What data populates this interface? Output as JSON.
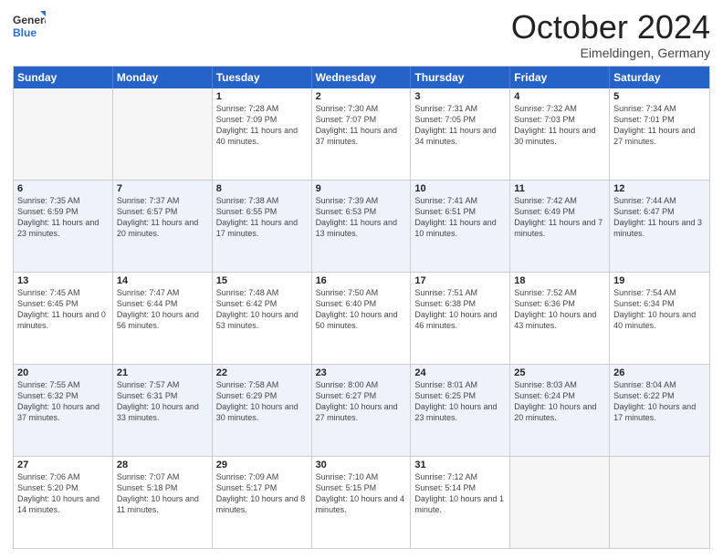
{
  "header": {
    "logo_general": "General",
    "logo_blue": "Blue",
    "month_title": "October 2024",
    "location": "Eimeldingen, Germany"
  },
  "days_of_week": [
    "Sunday",
    "Monday",
    "Tuesday",
    "Wednesday",
    "Thursday",
    "Friday",
    "Saturday"
  ],
  "weeks": [
    [
      {
        "day": "",
        "sunrise": "",
        "sunset": "",
        "daylight": "",
        "empty": true
      },
      {
        "day": "",
        "sunrise": "",
        "sunset": "",
        "daylight": "",
        "empty": true
      },
      {
        "day": "1",
        "sunrise": "Sunrise: 7:28 AM",
        "sunset": "Sunset: 7:09 PM",
        "daylight": "Daylight: 11 hours and 40 minutes.",
        "empty": false
      },
      {
        "day": "2",
        "sunrise": "Sunrise: 7:30 AM",
        "sunset": "Sunset: 7:07 PM",
        "daylight": "Daylight: 11 hours and 37 minutes.",
        "empty": false
      },
      {
        "day": "3",
        "sunrise": "Sunrise: 7:31 AM",
        "sunset": "Sunset: 7:05 PM",
        "daylight": "Daylight: 11 hours and 34 minutes.",
        "empty": false
      },
      {
        "day": "4",
        "sunrise": "Sunrise: 7:32 AM",
        "sunset": "Sunset: 7:03 PM",
        "daylight": "Daylight: 11 hours and 30 minutes.",
        "empty": false
      },
      {
        "day": "5",
        "sunrise": "Sunrise: 7:34 AM",
        "sunset": "Sunset: 7:01 PM",
        "daylight": "Daylight: 11 hours and 27 minutes.",
        "empty": false
      }
    ],
    [
      {
        "day": "6",
        "sunrise": "Sunrise: 7:35 AM",
        "sunset": "Sunset: 6:59 PM",
        "daylight": "Daylight: 11 hours and 23 minutes.",
        "empty": false
      },
      {
        "day": "7",
        "sunrise": "Sunrise: 7:37 AM",
        "sunset": "Sunset: 6:57 PM",
        "daylight": "Daylight: 11 hours and 20 minutes.",
        "empty": false
      },
      {
        "day": "8",
        "sunrise": "Sunrise: 7:38 AM",
        "sunset": "Sunset: 6:55 PM",
        "daylight": "Daylight: 11 hours and 17 minutes.",
        "empty": false
      },
      {
        "day": "9",
        "sunrise": "Sunrise: 7:39 AM",
        "sunset": "Sunset: 6:53 PM",
        "daylight": "Daylight: 11 hours and 13 minutes.",
        "empty": false
      },
      {
        "day": "10",
        "sunrise": "Sunrise: 7:41 AM",
        "sunset": "Sunset: 6:51 PM",
        "daylight": "Daylight: 11 hours and 10 minutes.",
        "empty": false
      },
      {
        "day": "11",
        "sunrise": "Sunrise: 7:42 AM",
        "sunset": "Sunset: 6:49 PM",
        "daylight": "Daylight: 11 hours and 7 minutes.",
        "empty": false
      },
      {
        "day": "12",
        "sunrise": "Sunrise: 7:44 AM",
        "sunset": "Sunset: 6:47 PM",
        "daylight": "Daylight: 11 hours and 3 minutes.",
        "empty": false
      }
    ],
    [
      {
        "day": "13",
        "sunrise": "Sunrise: 7:45 AM",
        "sunset": "Sunset: 6:45 PM",
        "daylight": "Daylight: 11 hours and 0 minutes.",
        "empty": false
      },
      {
        "day": "14",
        "sunrise": "Sunrise: 7:47 AM",
        "sunset": "Sunset: 6:44 PM",
        "daylight": "Daylight: 10 hours and 56 minutes.",
        "empty": false
      },
      {
        "day": "15",
        "sunrise": "Sunrise: 7:48 AM",
        "sunset": "Sunset: 6:42 PM",
        "daylight": "Daylight: 10 hours and 53 minutes.",
        "empty": false
      },
      {
        "day": "16",
        "sunrise": "Sunrise: 7:50 AM",
        "sunset": "Sunset: 6:40 PM",
        "daylight": "Daylight: 10 hours and 50 minutes.",
        "empty": false
      },
      {
        "day": "17",
        "sunrise": "Sunrise: 7:51 AM",
        "sunset": "Sunset: 6:38 PM",
        "daylight": "Daylight: 10 hours and 46 minutes.",
        "empty": false
      },
      {
        "day": "18",
        "sunrise": "Sunrise: 7:52 AM",
        "sunset": "Sunset: 6:36 PM",
        "daylight": "Daylight: 10 hours and 43 minutes.",
        "empty": false
      },
      {
        "day": "19",
        "sunrise": "Sunrise: 7:54 AM",
        "sunset": "Sunset: 6:34 PM",
        "daylight": "Daylight: 10 hours and 40 minutes.",
        "empty": false
      }
    ],
    [
      {
        "day": "20",
        "sunrise": "Sunrise: 7:55 AM",
        "sunset": "Sunset: 6:32 PM",
        "daylight": "Daylight: 10 hours and 37 minutes.",
        "empty": false
      },
      {
        "day": "21",
        "sunrise": "Sunrise: 7:57 AM",
        "sunset": "Sunset: 6:31 PM",
        "daylight": "Daylight: 10 hours and 33 minutes.",
        "empty": false
      },
      {
        "day": "22",
        "sunrise": "Sunrise: 7:58 AM",
        "sunset": "Sunset: 6:29 PM",
        "daylight": "Daylight: 10 hours and 30 minutes.",
        "empty": false
      },
      {
        "day": "23",
        "sunrise": "Sunrise: 8:00 AM",
        "sunset": "Sunset: 6:27 PM",
        "daylight": "Daylight: 10 hours and 27 minutes.",
        "empty": false
      },
      {
        "day": "24",
        "sunrise": "Sunrise: 8:01 AM",
        "sunset": "Sunset: 6:25 PM",
        "daylight": "Daylight: 10 hours and 23 minutes.",
        "empty": false
      },
      {
        "day": "25",
        "sunrise": "Sunrise: 8:03 AM",
        "sunset": "Sunset: 6:24 PM",
        "daylight": "Daylight: 10 hours and 20 minutes.",
        "empty": false
      },
      {
        "day": "26",
        "sunrise": "Sunrise: 8:04 AM",
        "sunset": "Sunset: 6:22 PM",
        "daylight": "Daylight: 10 hours and 17 minutes.",
        "empty": false
      }
    ],
    [
      {
        "day": "27",
        "sunrise": "Sunrise: 7:06 AM",
        "sunset": "Sunset: 5:20 PM",
        "daylight": "Daylight: 10 hours and 14 minutes.",
        "empty": false
      },
      {
        "day": "28",
        "sunrise": "Sunrise: 7:07 AM",
        "sunset": "Sunset: 5:18 PM",
        "daylight": "Daylight: 10 hours and 11 minutes.",
        "empty": false
      },
      {
        "day": "29",
        "sunrise": "Sunrise: 7:09 AM",
        "sunset": "Sunset: 5:17 PM",
        "daylight": "Daylight: 10 hours and 8 minutes.",
        "empty": false
      },
      {
        "day": "30",
        "sunrise": "Sunrise: 7:10 AM",
        "sunset": "Sunset: 5:15 PM",
        "daylight": "Daylight: 10 hours and 4 minutes.",
        "empty": false
      },
      {
        "day": "31",
        "sunrise": "Sunrise: 7:12 AM",
        "sunset": "Sunset: 5:14 PM",
        "daylight": "Daylight: 10 hours and 1 minute.",
        "empty": false
      },
      {
        "day": "",
        "sunrise": "",
        "sunset": "",
        "daylight": "",
        "empty": true
      },
      {
        "day": "",
        "sunrise": "",
        "sunset": "",
        "daylight": "",
        "empty": true
      }
    ]
  ]
}
